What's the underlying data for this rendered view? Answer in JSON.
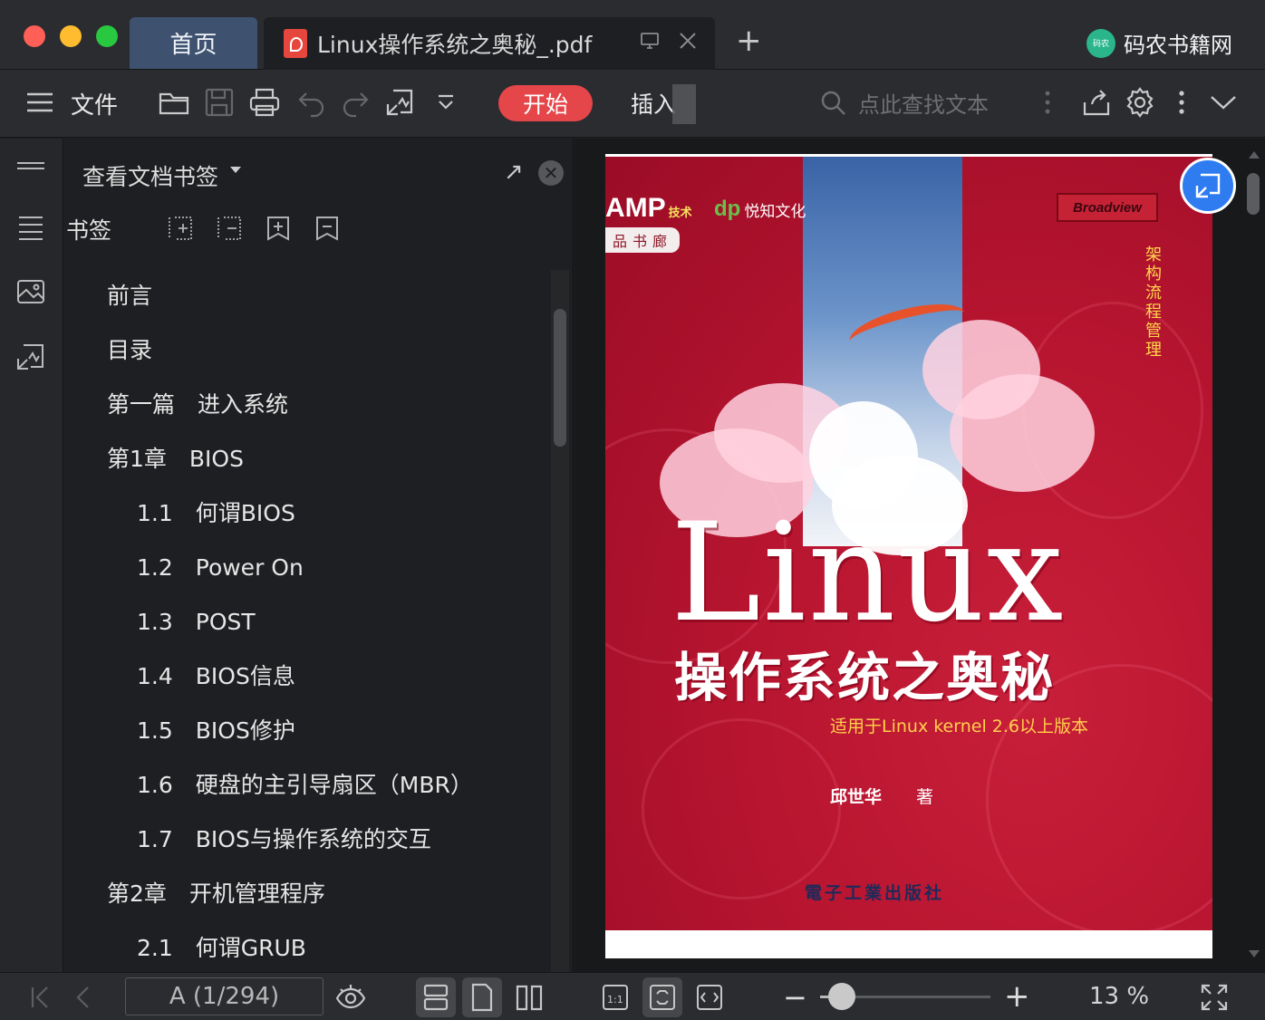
{
  "window": {
    "tabs": [
      {
        "label": "首页"
      },
      {
        "label": "Linux操作系统之奥秘_.pdf"
      }
    ],
    "new_tab": "+",
    "brand": {
      "logo_text": "码农",
      "name": "码农书籍网"
    }
  },
  "toolbar": {
    "file_label": "文件",
    "start_label": "开始",
    "insert_label": "插入",
    "search_placeholder": "点此查找文本"
  },
  "panel": {
    "title": "查看文档书签",
    "bookmark_label": "书签",
    "close_glyph": "✕",
    "expand_glyph": "↗",
    "items": [
      {
        "text": "前言",
        "level": 1
      },
      {
        "text": "目录",
        "level": 1
      },
      {
        "text": "第一篇　进入系统",
        "level": 1
      },
      {
        "text": "第1章　BIOS",
        "level": 1
      },
      {
        "text": "1.1　何谓BIOS",
        "level": 2
      },
      {
        "text": "1.2　Power On",
        "level": 2
      },
      {
        "text": "1.3　POST",
        "level": 2
      },
      {
        "text": "1.4　BIOS信息",
        "level": 2
      },
      {
        "text": "1.5　BIOS修护",
        "level": 2
      },
      {
        "text": "1.6　硬盘的主引导扇区（MBR）",
        "level": 2
      },
      {
        "text": "1.7　BIOS与操作系统的交互",
        "level": 2
      },
      {
        "text": "第2章　开机管理程序",
        "level": 1
      },
      {
        "text": "2.1　何谓GRUB",
        "level": 2
      }
    ]
  },
  "cover": {
    "amp": "AMP",
    "amp_small": "技术",
    "series": "品书廊",
    "publisher_logo": "悦知文化",
    "broadview": "Broadview",
    "side_text": "架构 流程 管理",
    "title": "Linux",
    "subtitle": "操作系统之奥秘",
    "version": "适用于Linux kernel 2.6以上版本",
    "author": "邱世华",
    "author_role": "著",
    "press": "電子工業出版社"
  },
  "statusbar": {
    "page_display": "A (1/294)",
    "zoom_value": "13 %",
    "zoom_fraction": 0.13,
    "minus": "−",
    "plus": "+"
  },
  "colors": {
    "accent": "#e5464a",
    "active_tab": "#3e5270",
    "float_button": "#2f7cf1",
    "cover_red": "#b81530"
  }
}
